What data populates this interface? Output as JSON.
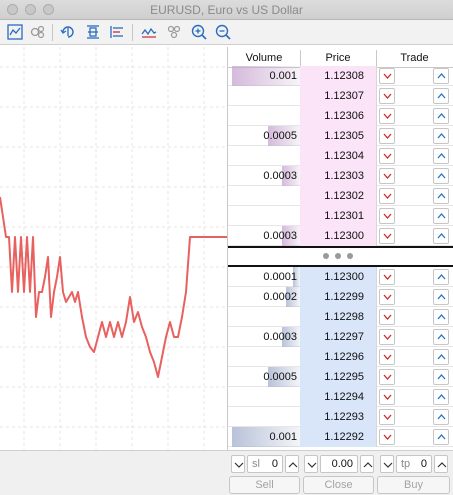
{
  "window": {
    "title": "EURUSD, Euro vs US Dollar"
  },
  "toolbar": {
    "icons": [
      "chart-settings-icon",
      "signals-icon",
      "one-click-trading-icon",
      "center-price-icon",
      "depth-icon",
      "tick-chart-icon",
      "indicators-icon",
      "zoom-in-icon",
      "zoom-out-icon"
    ]
  },
  "columns": {
    "volume": "Volume",
    "price": "Price",
    "trade": "Trade"
  },
  "asks": [
    {
      "volume": "0.001",
      "price": "1.12308",
      "vol_level": 0.95
    },
    {
      "volume": "",
      "price": "1.12307",
      "vol_level": 0
    },
    {
      "volume": "",
      "price": "1.12306",
      "vol_level": 0
    },
    {
      "volume": "0.0005",
      "price": "1.12305",
      "vol_level": 0.45
    },
    {
      "volume": "",
      "price": "1.12304",
      "vol_level": 0
    },
    {
      "volume": "0.0003",
      "price": "1.12303",
      "vol_level": 0.25
    },
    {
      "volume": "",
      "price": "1.12302",
      "vol_level": 0
    },
    {
      "volume": "",
      "price": "1.12301",
      "vol_level": 0
    },
    {
      "volume": "0.0003",
      "price": "1.12300",
      "vol_level": 0.25
    }
  ],
  "bids": [
    {
      "volume": "0.0001",
      "price": "1.12300",
      "vol_level": 0.1
    },
    {
      "volume": "0.0002",
      "price": "1.12299",
      "vol_level": 0.2
    },
    {
      "volume": "",
      "price": "1.12298",
      "vol_level": 0
    },
    {
      "volume": "0.0003",
      "price": "1.12297",
      "vol_level": 0.25
    },
    {
      "volume": "",
      "price": "1.12296",
      "vol_level": 0
    },
    {
      "volume": "0.0005",
      "price": "1.12295",
      "vol_level": 0.45
    },
    {
      "volume": "",
      "price": "1.12294",
      "vol_level": 0
    },
    {
      "volume": "",
      "price": "1.12293",
      "vol_level": 0
    },
    {
      "volume": "0.001",
      "price": "1.12292",
      "vol_level": 0.95
    }
  ],
  "colors": {
    "line": "#e8615f",
    "ask_bg": "#fbe3f8",
    "bid_bg": "#d9e6fa",
    "ask_vol": "#c9a9d2",
    "bid_vol": "#a7b4cf",
    "arrow_down": "#cc2b2b",
    "arrow_up": "#2474c0"
  },
  "controls": {
    "sl_label": "sl",
    "sl_value": "0",
    "volume_value": "0.00",
    "tp_label": "tp",
    "tp_value": "0",
    "sell_label": "Sell",
    "close_label": "Close",
    "buy_label": "Buy"
  }
}
